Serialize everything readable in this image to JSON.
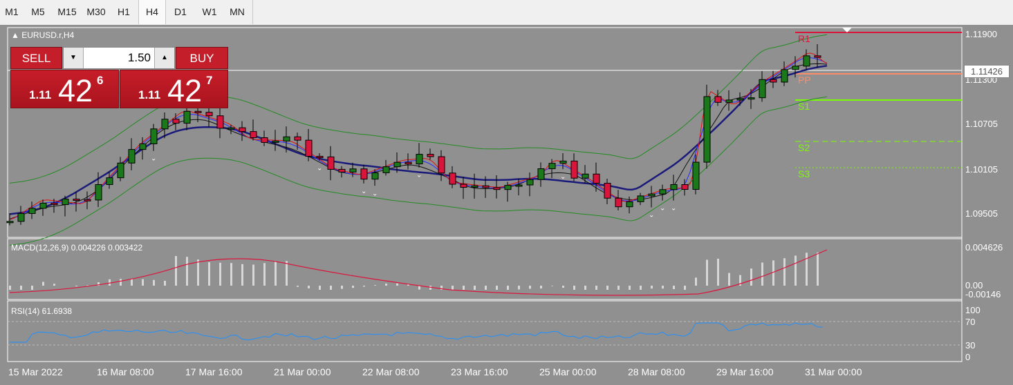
{
  "timeframes": [
    "M1",
    "M5",
    "M15",
    "M30",
    "H1",
    "H4",
    "D1",
    "W1",
    "MN"
  ],
  "active_timeframe": "H4",
  "symbol": "EURUSD.r,H4",
  "trade_panel": {
    "sell_label": "SELL",
    "buy_label": "BUY",
    "lot": "1.50",
    "sell_price": {
      "prefix": "1.11",
      "big": "42",
      "sup": "6"
    },
    "buy_price": {
      "prefix": "1.11",
      "big": "42",
      "sup": "7"
    }
  },
  "price_axis": [
    "1.11900",
    "1.11300",
    "1.10705",
    "1.10105",
    "1.09505"
  ],
  "current_price": "1.11426",
  "pivots": [
    "R1",
    "PP",
    "S1",
    "S2",
    "S3"
  ],
  "macd": {
    "label": "MACD(12,26,9) 0.004226 0.003422",
    "axis": [
      "0.004626",
      "0.00",
      "-0.00146"
    ]
  },
  "rsi": {
    "label": "RSI(14) 61.6938",
    "axis": [
      "100",
      "70",
      "30",
      "0"
    ]
  },
  "dates": [
    "15 Mar 2022",
    "16 Mar 08:00",
    "17 Mar 16:00",
    "21 Mar 00:00",
    "22 Mar 08:00",
    "23 Mar 16:00",
    "25 Mar 00:00",
    "28 Mar 08:00",
    "29 Mar 16:00",
    "31 Mar 00:00"
  ],
  "colors": {
    "bull": "#1a7a1a",
    "bear": "#dc143c",
    "r1": "#dc143c",
    "pp": "#ff8c69",
    "support": "#7cfc00"
  }
}
